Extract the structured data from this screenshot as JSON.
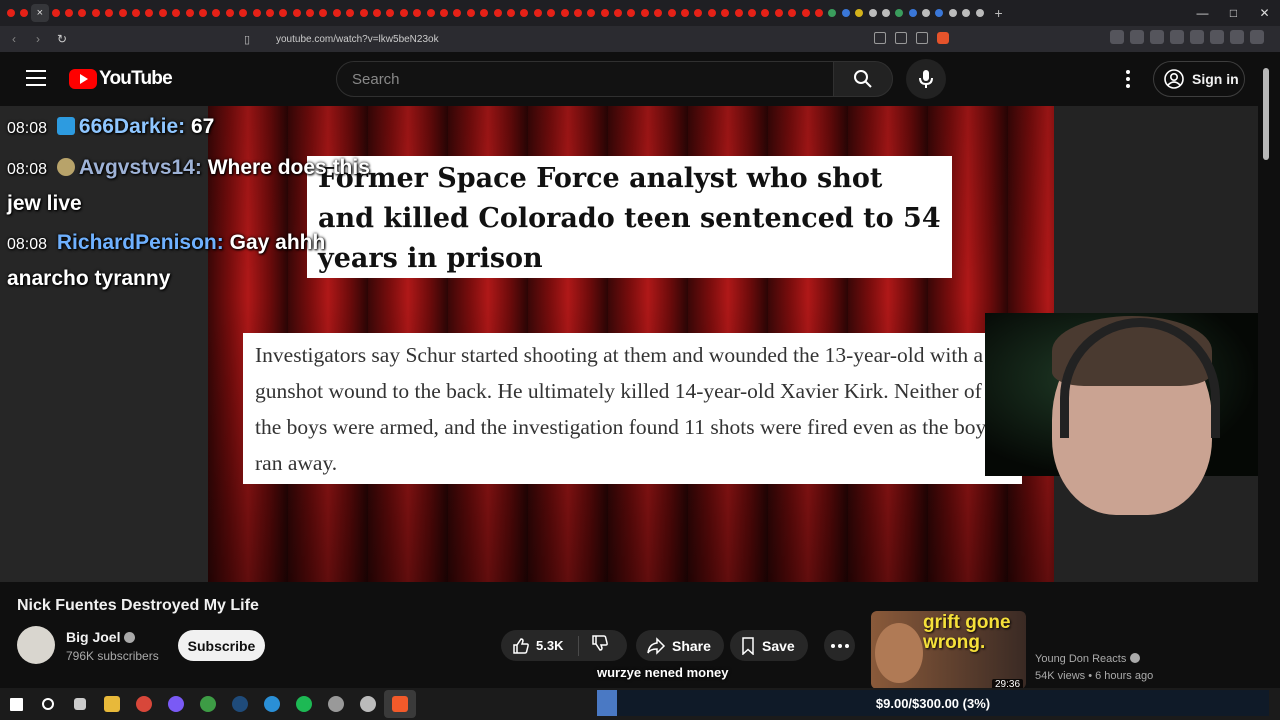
{
  "browser": {
    "url": "youtube.com/watch?v=lkw5beN23ok",
    "tab_close_glyph": "×",
    "new_tab_glyph": "+"
  },
  "youtube": {
    "logo_text": "YouTube",
    "search_placeholder": "Search",
    "sign_in_label": "Sign in"
  },
  "video": {
    "headline": "Former Space Force analyst who shot and killed Colorado teen sentenced to 54 years in prison",
    "excerpt": "Investigators say Schur started shooting at them and wounded the 13-year-old with a gunshot wound to the back. He ultimately killed 14-year-old Xavier Kirk. Neither of the boys were armed, and the investigation found 11 shots were fired even as the boys ran away.",
    "chat": [
      {
        "time": "08:08",
        "user": "666Darkie:",
        "text": "67"
      },
      {
        "time": "08:08",
        "user": "Avgvstvs14:",
        "text": "Where does this jew live"
      },
      {
        "time": "08:08",
        "user": "RichardPenison:",
        "text": "Gay ahhh anarcho tyranny"
      }
    ]
  },
  "details": {
    "title": "Nick Fuentes Destroyed My Life",
    "channel": "Big Joel",
    "subscribers": "796K subscribers",
    "subscribe_label": "Subscribe",
    "likes": "5.3K",
    "share_label": "Share",
    "save_label": "Save"
  },
  "recommended": {
    "thumb_text": "grift gone wrong.",
    "duration": "29:36",
    "channel": "Young Don Reacts",
    "meta": "54K views • 6 hours ago"
  },
  "overlay": {
    "donation_text": "wurzye nened money",
    "goal_text": "$9.00/$300.00 (3%)",
    "goal_progress": 0.03
  },
  "colors": {
    "youtube_red": "#ff0000",
    "background": "#0f0f0f",
    "goal_bar": "#4a79c4"
  }
}
